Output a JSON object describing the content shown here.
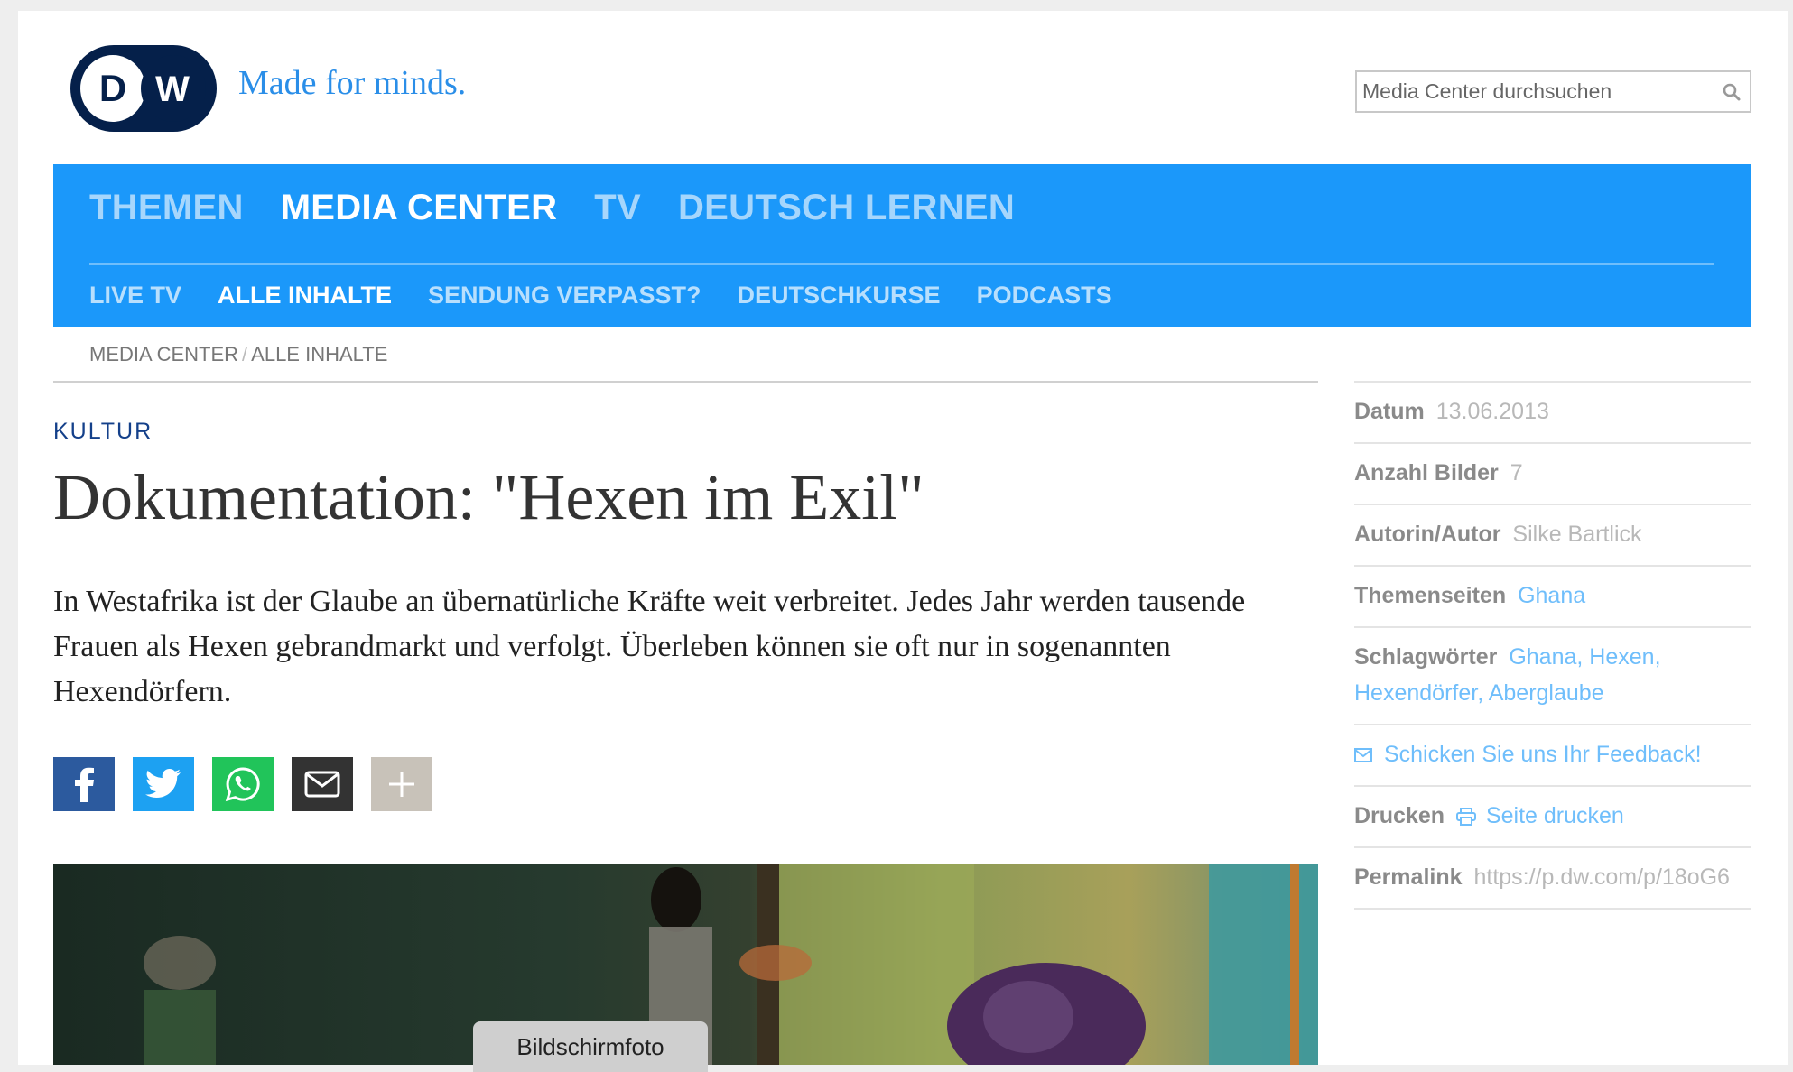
{
  "header": {
    "logo_text": "DW",
    "tagline": "Made for minds.",
    "search_placeholder": "Media Center durchsuchen"
  },
  "nav": {
    "main": [
      {
        "label": "THEMEN",
        "active": false
      },
      {
        "label": "MEDIA CENTER",
        "active": true
      },
      {
        "label": "TV",
        "active": false
      },
      {
        "label": "DEUTSCH LERNEN",
        "active": false
      }
    ],
    "sub": [
      {
        "label": "LIVE TV",
        "active": false
      },
      {
        "label": "ALLE INHALTE",
        "active": true
      },
      {
        "label": "SENDUNG VERPASST?",
        "active": false
      },
      {
        "label": "DEUTSCHKURSE",
        "active": false
      },
      {
        "label": "PODCASTS",
        "active": false
      }
    ]
  },
  "breadcrumb": {
    "items": [
      "MEDIA CENTER",
      "ALLE INHALTE"
    ],
    "separator": "/"
  },
  "article": {
    "category": "KULTUR",
    "title": "Dokumentation: \"Hexen im Exil\"",
    "lead": "In Westafrika ist der Glaube an übernatürliche Kräfte weit verbreitet. Jedes Jahr werden tausende Frauen als Hexen gebrandmarkt und verfolgt. Überleben können sie oft nur in sogenannten Hexendörfern."
  },
  "share": {
    "icons": [
      "facebook-icon",
      "twitter-icon",
      "whatsapp-icon",
      "mail-icon",
      "plus-icon"
    ]
  },
  "tooltip": "Bildschirmfoto",
  "sidebar": {
    "datum_label": "Datum",
    "datum_value": "13.06.2013",
    "bilder_label": "Anzahl Bilder",
    "bilder_value": "7",
    "autor_label": "Autorin/Autor",
    "autor_value": "Silke Bartlick",
    "themen_label": "Themenseiten",
    "themen_value": "Ghana",
    "schlag_label": "Schlagwörter",
    "schlag_values": [
      "Ghana",
      "Hexen",
      "Hexendörfer",
      "Aberglaube"
    ],
    "feedback_label": "Schicken Sie uns Ihr Feedback!",
    "drucken_label": "Drucken",
    "drucken_link": "Seite drucken",
    "permalink_label": "Permalink",
    "permalink_value": "https://p.dw.com/p/18oG6"
  },
  "colors": {
    "nav_blue": "#1b98fa",
    "dw_navy": "#05204a",
    "category_blue": "#14408a",
    "link_blue": "#6fbefb"
  }
}
